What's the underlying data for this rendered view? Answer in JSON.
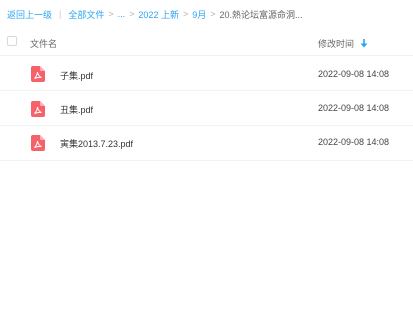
{
  "breadcrumb": {
    "back": "返回上一级",
    "all_files": "全部文件",
    "ellipsis": "...",
    "items": [
      "2022 上新",
      "9月"
    ],
    "current": "20.熱论坛富源命洞..."
  },
  "table": {
    "col_name": "文件名",
    "col_modified": "修改时间",
    "sort": "descending",
    "rows": [
      {
        "name": "子集.pdf",
        "modified": "2022-09-08 14:08",
        "icon": "pdf-icon"
      },
      {
        "name": "丑集.pdf",
        "modified": "2022-09-08 14:08",
        "icon": "pdf-icon"
      },
      {
        "name": "寅集2013.7.23.pdf",
        "modified": "2022-09-08 14:08",
        "icon": "pdf-icon"
      }
    ]
  },
  "colors": {
    "link": "#2aa4f4",
    "pdf_red": "#f5626a",
    "sort_blue": "#2aa4f4"
  }
}
